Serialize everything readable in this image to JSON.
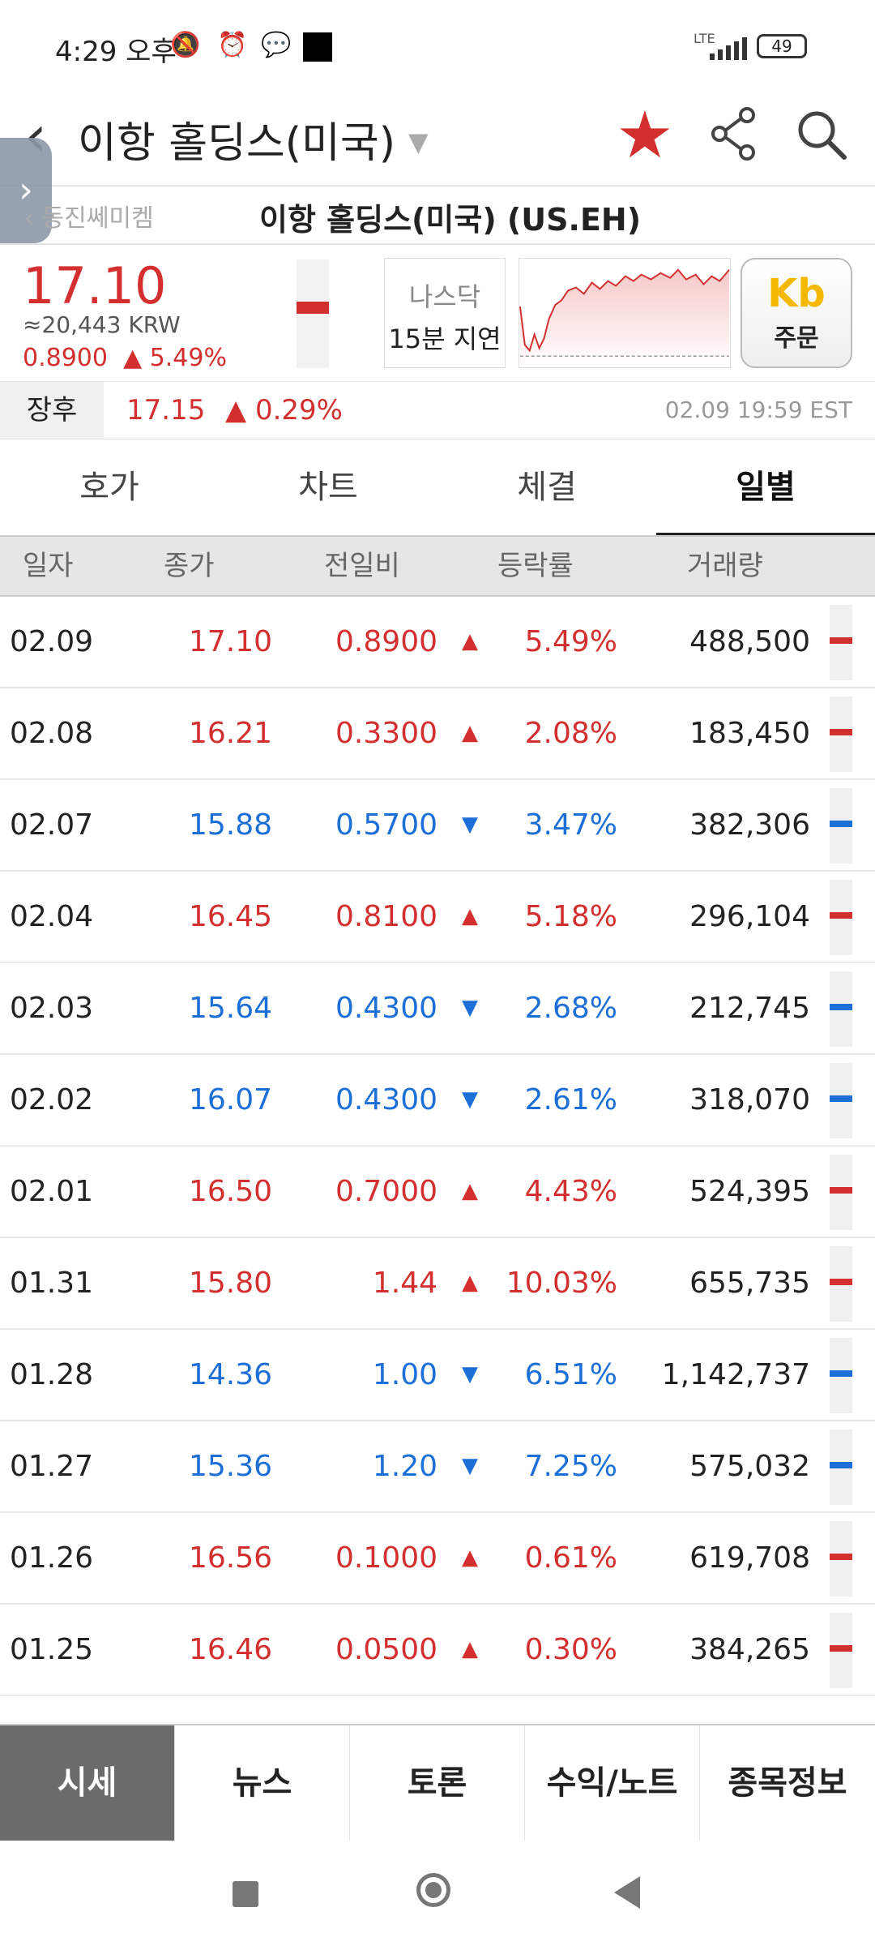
{
  "status_bar": {
    "time": "4:29 오후",
    "network": "LTE",
    "battery": "49",
    "icons": [
      "mute-icon",
      "alarm-icon",
      "blog-icon"
    ]
  },
  "header": {
    "title": "이항 홀딩스(미국)",
    "icons": [
      "back-icon",
      "star-icon",
      "share-icon",
      "search-icon"
    ]
  },
  "subheader": {
    "prev_link": "동진쎄미켐",
    "title": "이항 홀딩스(미국) (US.EH)"
  },
  "quote": {
    "price": "17.10",
    "krw": "≈20,443 KRW",
    "change": "0.8900",
    "change_rate": "▲ 5.49%",
    "market": "나스닥",
    "delay": "15분 지연",
    "order_label": "주문",
    "order_logo": "Kb"
  },
  "after_hours": {
    "label": "장후",
    "price": "17.15",
    "change": "▲ 0.29%",
    "time": "02.09 19:59 EST"
  },
  "tabs": [
    "호가",
    "차트",
    "체결",
    "일별"
  ],
  "active_tab": "일별",
  "table": {
    "headers": [
      "일자",
      "종가",
      "전일비",
      "등락률",
      "거래량"
    ],
    "rows": [
      {
        "date": "02.09",
        "close": "17.10",
        "diff": "0.8900",
        "arrow": "▲",
        "rate": "5.49%",
        "volume": "488,500",
        "dir": "up"
      },
      {
        "date": "02.08",
        "close": "16.21",
        "diff": "0.3300",
        "arrow": "▲",
        "rate": "2.08%",
        "volume": "183,450",
        "dir": "up"
      },
      {
        "date": "02.07",
        "close": "15.88",
        "diff": "0.5700",
        "arrow": "▼",
        "rate": "3.47%",
        "volume": "382,306",
        "dir": "down"
      },
      {
        "date": "02.04",
        "close": "16.45",
        "diff": "0.8100",
        "arrow": "▲",
        "rate": "5.18%",
        "volume": "296,104",
        "dir": "up"
      },
      {
        "date": "02.03",
        "close": "15.64",
        "diff": "0.4300",
        "arrow": "▼",
        "rate": "2.68%",
        "volume": "212,745",
        "dir": "down"
      },
      {
        "date": "02.02",
        "close": "16.07",
        "diff": "0.4300",
        "arrow": "▼",
        "rate": "2.61%",
        "volume": "318,070",
        "dir": "down"
      },
      {
        "date": "02.01",
        "close": "16.50",
        "diff": "0.7000",
        "arrow": "▲",
        "rate": "4.43%",
        "volume": "524,395",
        "dir": "up"
      },
      {
        "date": "01.31",
        "close": "15.80",
        "diff": "1.44",
        "arrow": "▲",
        "rate": "10.03%",
        "volume": "655,735",
        "dir": "up"
      },
      {
        "date": "01.28",
        "close": "14.36",
        "diff": "1.00",
        "arrow": "▼",
        "rate": "6.51%",
        "volume": "1,142,737",
        "dir": "down"
      },
      {
        "date": "01.27",
        "close": "15.36",
        "diff": "1.20",
        "arrow": "▼",
        "rate": "7.25%",
        "volume": "575,032",
        "dir": "down"
      },
      {
        "date": "01.26",
        "close": "16.56",
        "diff": "0.1000",
        "arrow": "▲",
        "rate": "0.61%",
        "volume": "619,708",
        "dir": "up"
      },
      {
        "date": "01.25",
        "close": "16.46",
        "diff": "0.0500",
        "arrow": "▲",
        "rate": "0.30%",
        "volume": "384,265",
        "dir": "up"
      }
    ]
  },
  "bottom_tabs": [
    "시세",
    "뉴스",
    "토론",
    "수익/노트",
    "종목정보"
  ],
  "active_bottom_tab": "시세",
  "colors": {
    "up": "#d32f2f",
    "down": "#1c6fd6",
    "accent_star": "#d32f2f"
  }
}
